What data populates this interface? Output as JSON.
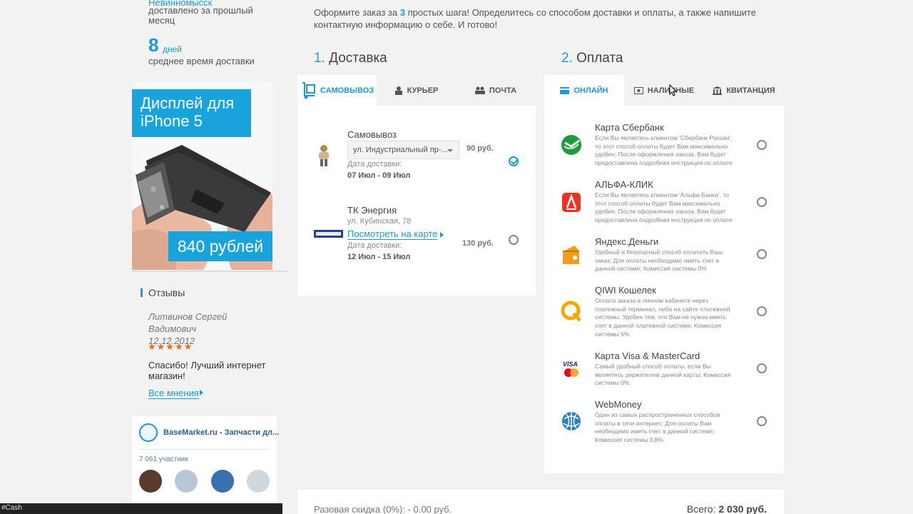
{
  "stats": {
    "city": "Невинномысск",
    "delivered_caption": "доставлено за прошлый месяц",
    "days_number": "8",
    "days_word": "дней",
    "days_caption": "среднее время доставки"
  },
  "promo": {
    "title": "Дисплей для iPhone 5",
    "price": "840 рублей"
  },
  "reviews": {
    "title": "Отзывы",
    "author": "Литвинов Сергей Вадимович",
    "date": "12.12.2012",
    "stars": "★★★★★",
    "rating": 5,
    "text": "Спасибо! Лучший интернет магазин!",
    "more_link": "Все мнения"
  },
  "vk_widget": {
    "group_name": "BaseMarket.ru - Запчасти дл...",
    "members": "7 061 участник"
  },
  "status_bar": "#Cash",
  "intro": {
    "before": "Оформите заказ за ",
    "steps": "3",
    "after": " простых шага! Определитесь со способом доставки и оплаты, а также напишите контактную информацию о себе. И готово!"
  },
  "delivery": {
    "step_num": "1.",
    "step_title": "Доставка",
    "tabs": [
      "САМОВЫВОЗ",
      "КУРЬЕР",
      "ПОЧТА"
    ],
    "active_tab": 0,
    "options": [
      {
        "name": "Самовывоз",
        "select_value": "ул. Индустриальный пр-...",
        "date_label": "Дата доставки:",
        "date": "07 Июл - 09 Июл",
        "price": "90 руб.",
        "selected": true
      },
      {
        "name": "ТК Энергия",
        "address": "ул. Кубинская, 78",
        "map_link": "Посмотреть на карте",
        "date_label": "Дата доставки:",
        "date": "12 Июл - 15 Июл",
        "price": "130 руб.",
        "selected": false
      }
    ]
  },
  "payment": {
    "step_num": "2.",
    "step_title": "Оплата",
    "tabs": [
      "ОНЛАЙН",
      "НАЛИЧНЫЕ",
      "КВИТАНЦИЯ"
    ],
    "active_tab": 0,
    "methods": [
      {
        "name": "Карта Сбербанк",
        "desc": "Если Вы являетесь клиентом 'Сбербанк России', то этот способ оплаты будет Вам максимально удобен; После оформления заказа, Вам будет предоставлена подробная инструкция по оплате",
        "icon": "sberbank-icon",
        "color": "#1d9c3a"
      },
      {
        "name": "АЛЬФА-КЛИК",
        "desc": "Если Вы являетесь клиентом 'Альфа-Банка', то этот способ оплаты будет Вам максимально удобен; После оформления заказа, Вам будет предоставлена подробная инструкция по оплате",
        "icon": "alfa-bank-icon",
        "color": "#ef3124"
      },
      {
        "name": "Яндекс.Деньги",
        "desc": "Удобный и безопасный способ оплатить Ваш заказ; Для оплаты необходимо иметь счет в данной системе; Комиссия системы 0%",
        "icon": "yandex-money-icon",
        "color": "#f29b1d"
      },
      {
        "name": "QIWI Кошелек",
        "desc": "Оплата заказа в личном кабинете через платежный терминал, либо на сайте платежной системы; Удобен тем, что Вам не нужно иметь счет в данной платежной системе; Комиссия системы 5%",
        "icon": "qiwi-icon",
        "color": "#f7a600"
      },
      {
        "name": "Карта Visa & MasterCard",
        "desc": "Самый удобный способ оплаты, если Вы являетесь держателем данной карты; Комиссия системы 0%",
        "icon": "visa-mastercard-icon",
        "color": "#1a1f71"
      },
      {
        "name": "WebMoney",
        "desc": "Один из самых распространенных способов оплаты в сети интернет; Для оплаты Вам необходимо иметь счет в данной системе; Комиссия системы 0,8%",
        "icon": "webmoney-icon",
        "color": "#2a7fc0"
      }
    ]
  },
  "summary": {
    "discount": "Разовая скидка (0%): - 0.00 руб.",
    "total_label": "Всего:",
    "total_value": "2 030 руб."
  }
}
